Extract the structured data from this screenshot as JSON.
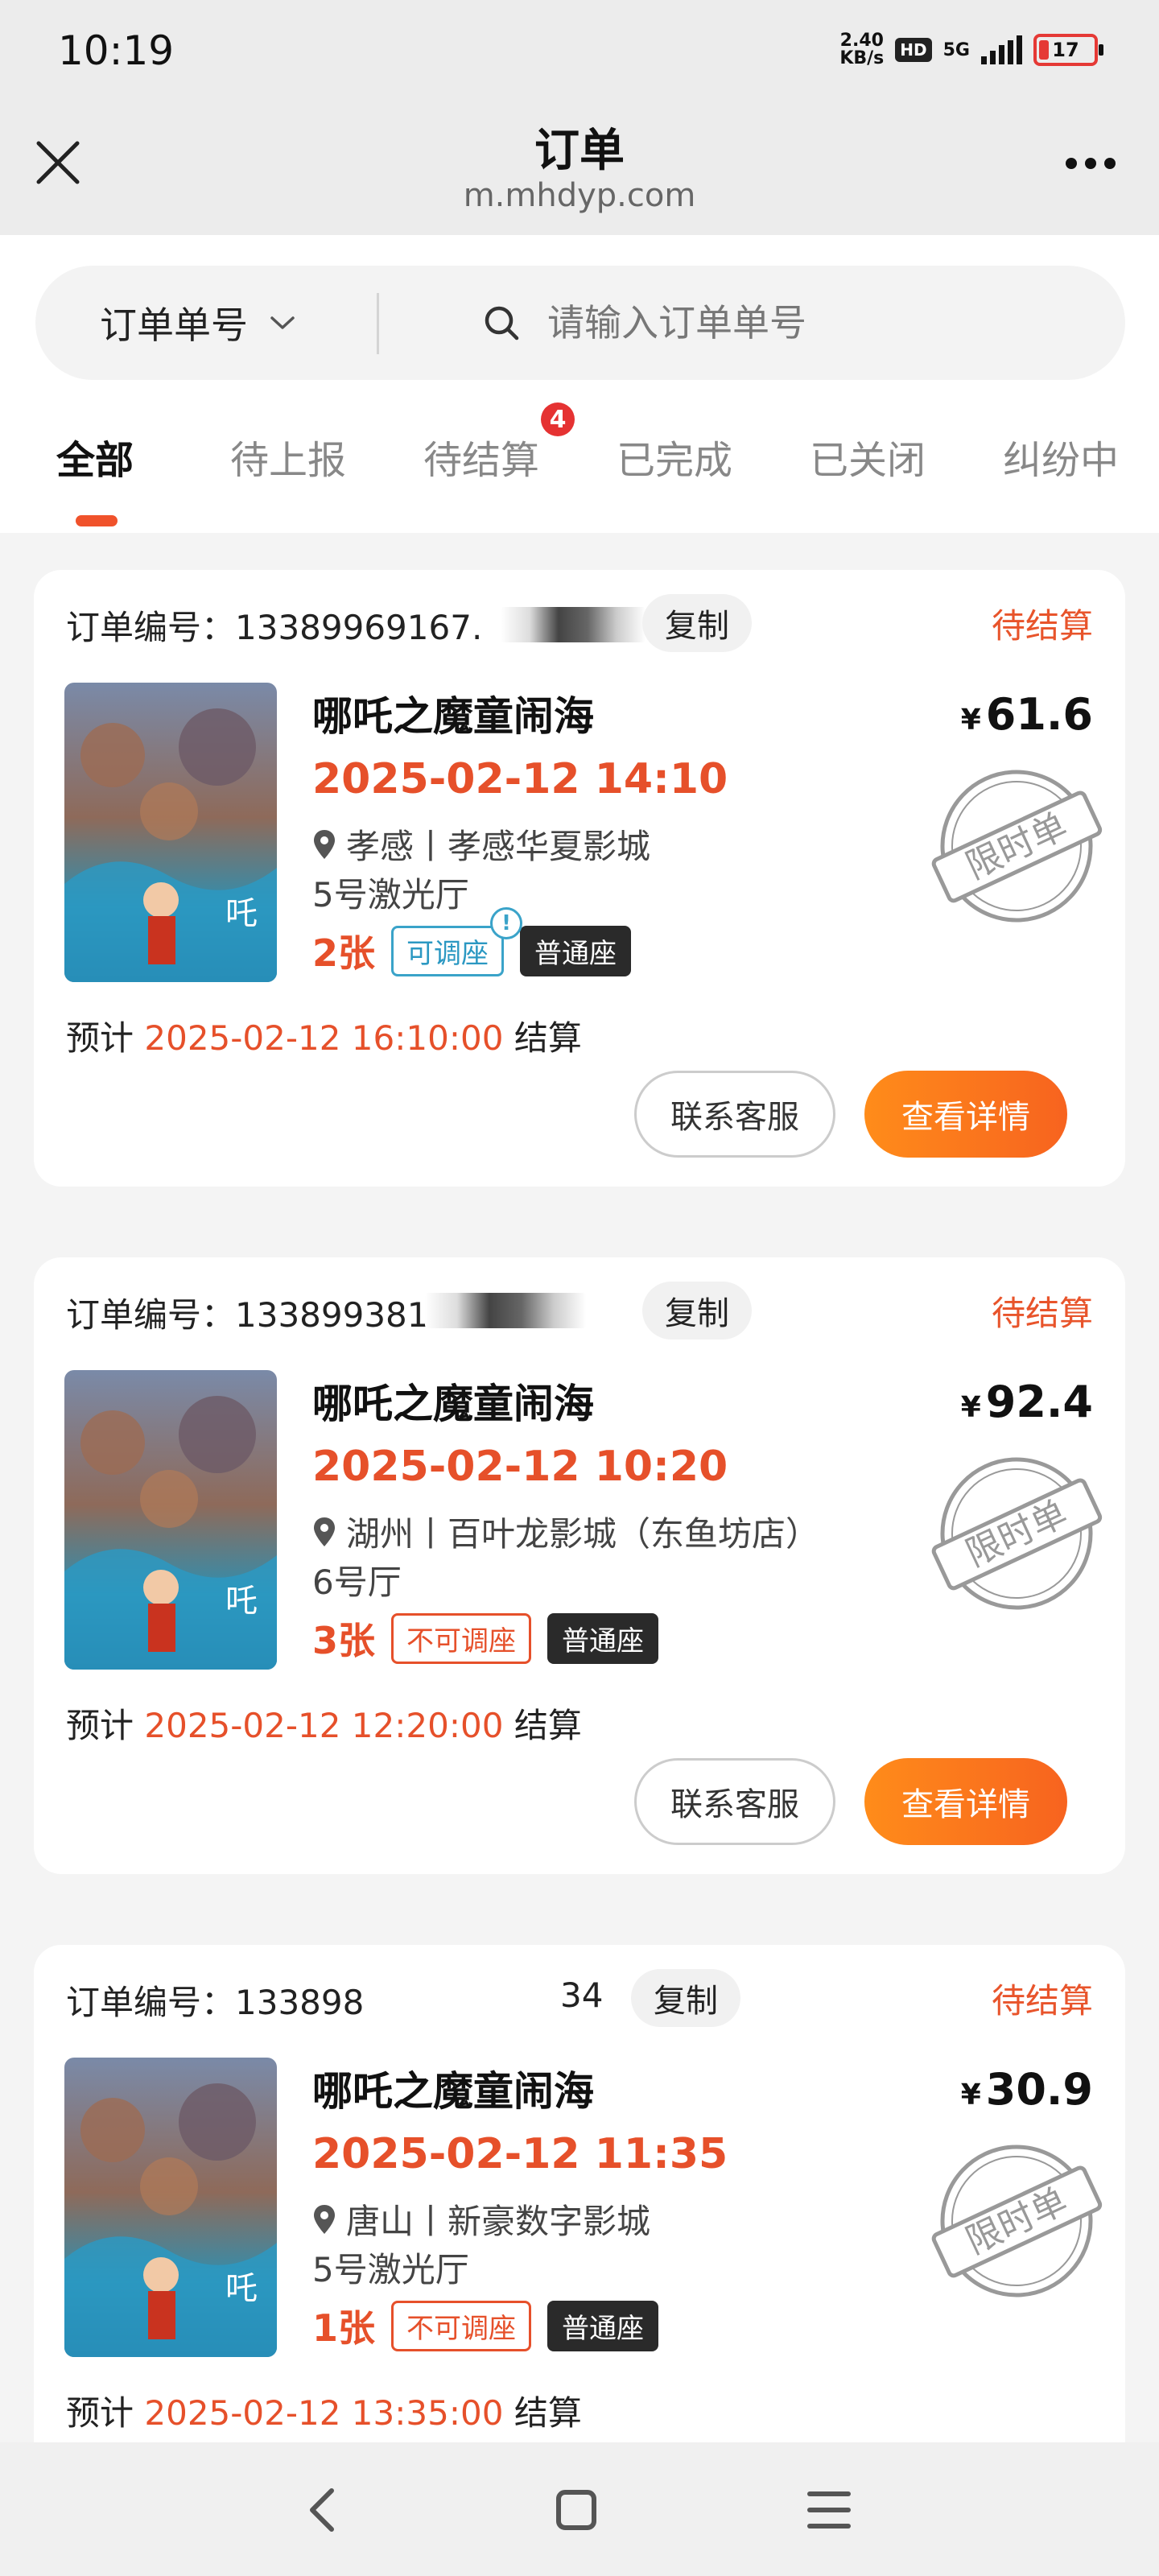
{
  "status_bar": {
    "time": "10:19",
    "speed_value": "2.40",
    "speed_unit": "KB/s",
    "hd": "HD",
    "network": "5G",
    "battery": "17"
  },
  "header": {
    "title": "订单",
    "url": "m.mhdyp.com"
  },
  "search": {
    "type_label": "订单单号",
    "placeholder": "请输入订单单号"
  },
  "tabs": [
    {
      "label": "全部"
    },
    {
      "label": "待上报"
    },
    {
      "label": "待结算",
      "badge": "4"
    },
    {
      "label": "已完成"
    },
    {
      "label": "已关闭"
    },
    {
      "label": "纠纷中"
    }
  ],
  "orders": [
    {
      "order_label": "订单编号：133899691​67.",
      "copy": "复制",
      "status": "待结算",
      "movie": "哪吒之魔童闹海",
      "showtime": "2025-02-12 14:10",
      "location": "孝感丨孝感华夏影城",
      "hall": "5号激光厅",
      "qty": "2张",
      "adjust_tag": "可调座",
      "seat_tag": "普通座",
      "currency": "¥",
      "price": "61.6",
      "stamp": "限时单",
      "settle_prefix": "预计",
      "settle_time": "2025-02-12 16:10:00",
      "settle_suffix": "结算",
      "btn_service": "联系客服",
      "btn_detail": "查看详情"
    },
    {
      "order_label": "订单编号：13389938​12",
      "copy": "复制",
      "status": "待结算",
      "movie": "哪吒之魔童闹海",
      "showtime": "2025-02-12 10:20",
      "location": "湖州丨百叶龙影城（东鱼坊店）",
      "hall": "6号厅",
      "qty": "3张",
      "adjust_tag": "不可调座",
      "seat_tag": "普通座",
      "currency": "¥",
      "price": "92.4",
      "stamp": "限时单",
      "settle_prefix": "预计",
      "settle_time": "2025-02-12 12:20:00",
      "settle_suffix": "结算",
      "btn_service": "联系客服",
      "btn_detail": "查看详情"
    },
    {
      "order_label": "订单编号：133898",
      "order_label_tail": "34",
      "copy": "复制",
      "status": "待结算",
      "movie": "哪吒之魔童闹海",
      "showtime": "2025-02-12 11:35",
      "location": "唐山丨新豪数字影城",
      "hall": "5号激光厅",
      "qty": "1张",
      "adjust_tag": "不可调座",
      "seat_tag": "普通座",
      "currency": "¥",
      "price": "30.9",
      "stamp": "限时单",
      "settle_prefix": "预计",
      "settle_time": "2025-02-12 13:35:00",
      "settle_suffix": "结算"
    }
  ],
  "colors": {
    "accent": "#e6502a",
    "button_gradient_start": "#ff8c1a",
    "button_gradient_end": "#f7631f",
    "tag_blue": "#3aa3c9"
  }
}
